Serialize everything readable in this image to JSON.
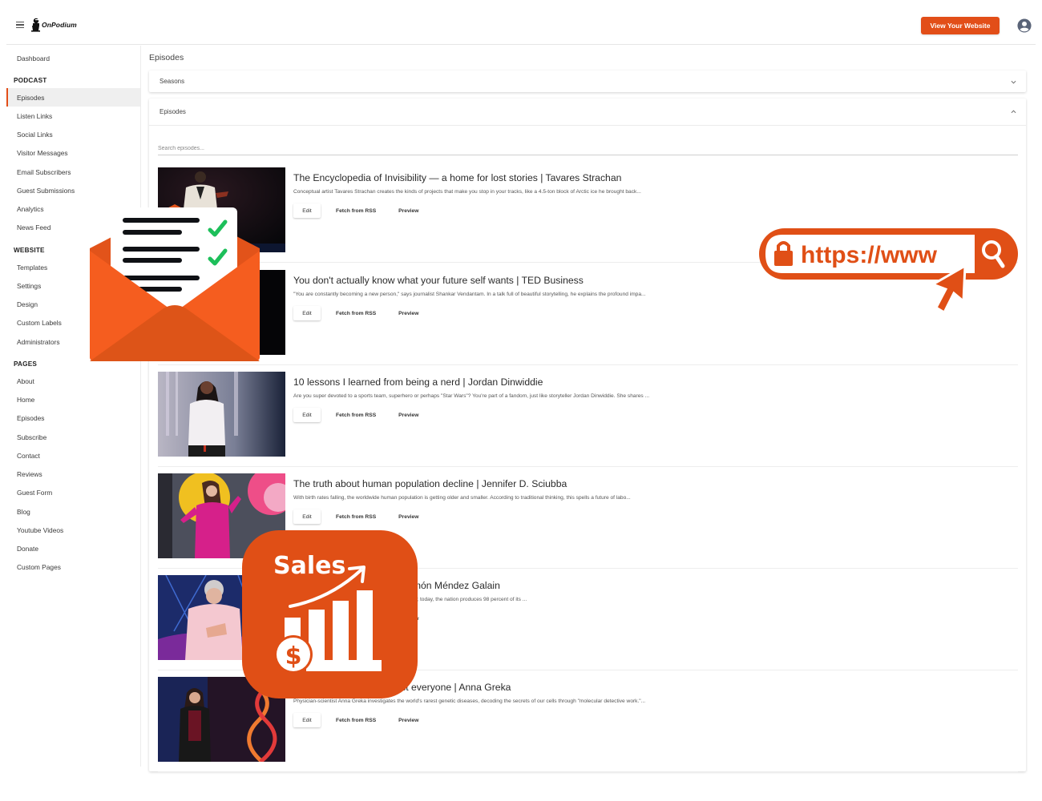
{
  "header": {
    "brand": "OnPodium",
    "view_site_label": "View Your Website",
    "brand_color": "#e24e18"
  },
  "sidebar": {
    "dashboard": "Dashboard",
    "sections": [
      {
        "title": "PODCAST",
        "items": [
          "Episodes",
          "Listen Links",
          "Social Links",
          "Visitor Messages",
          "Email Subscribers",
          "Guest Submissions",
          "Analytics",
          "News Feed"
        ]
      },
      {
        "title": "WEBSITE",
        "items": [
          "Templates",
          "Settings",
          "Design",
          "Custom Labels",
          "Administrators"
        ]
      },
      {
        "title": "PAGES",
        "items": [
          "About",
          "Home",
          "Episodes",
          "Subscribe",
          "Contact",
          "Reviews",
          "Guest Form",
          "Blog",
          "Youtube Videos",
          "Donate",
          "Custom Pages"
        ]
      }
    ],
    "active_item": "Episodes"
  },
  "main": {
    "page_title": "Episodes",
    "seasons_panel": {
      "label": "Seasons",
      "expanded": false
    },
    "episodes_panel": {
      "label": "Episodes",
      "expanded": true
    },
    "search": {
      "placeholder": "Search episodes...",
      "value": ""
    },
    "actions": {
      "edit": "Edit",
      "fetch": "Fetch from RSS",
      "preview": "Preview"
    },
    "episodes": [
      {
        "title": "The Encyclopedia of Invisibility — a home for lost stories | Tavares Strachan",
        "description": "Conceptual artist Tavares Strachan creates the kinds of projects that make you stop in your tracks, like a 4.5-ton block of Arctic ice he brought back..."
      },
      {
        "title": "You don't actually know what your future self wants | TED Business",
        "description": "\"You are constantly becoming a new person,\" says journalist Shankar Vendantam. In a talk full of beautiful storytelling, he explains the profound impa..."
      },
      {
        "title": "10 lessons I learned from being a nerd | Jordan Dinwiddie",
        "description": "Are you super devoted to a sports team, superhero or perhaps \"Star Wars\"? You're part of a fandom, just like storyteller Jordan Dinwiddie. She shares ..."
      },
      {
        "title": "The truth about human population decline | Jennifer D. Sciubba",
        "description": "With birth rates falling, the worldwide human population is getting older and smaller. According to traditional thinking, this spells a future of labo..."
      },
      {
        "title": "cent renewable energy | Ramón Méndez Galain",
        "description": "energy crisis brought on by its reliance on fossil fuels; today, the nation produces 98 percent of its ..."
      },
      {
        "title": "es — and how they impact everyone | Anna Greka",
        "description": "Physician-scientist Anna Greka investigates the world's rarest genetic diseases, decoding the secrets of our cells through \"molecular detective work.\"..."
      }
    ]
  },
  "overlays": {
    "url_bar_text": "https://www",
    "sales_label": "Sales",
    "sales_currency": "$",
    "overlay_color": "#e04f16",
    "envelope_color": "#f55d1f",
    "check_color": "#1dbf5a"
  }
}
